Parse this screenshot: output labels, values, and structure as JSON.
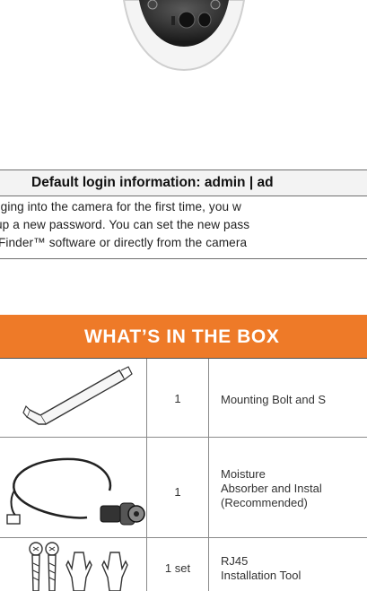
{
  "login_info": {
    "text": "Default login information: admin | ad"
  },
  "notice": {
    "lines": [
      "gging into the camera for the first time, you w",
      "up a new password. You can set the new pass",
      "Finder™ software or directly from the camera"
    ]
  },
  "box": {
    "title": "WHAT’S IN THE BOX",
    "items": [
      {
        "qty": "1",
        "label_lines": [
          "Mounting Bolt and S"
        ]
      },
      {
        "qty": "1",
        "label_lines": [
          "Moisture",
          "Absorber and Instal",
          "(Recommended)"
        ]
      },
      {
        "qty": "1 set",
        "label_lines": [
          "RJ45",
          "Installation Tool"
        ]
      }
    ]
  },
  "colors": {
    "accent": "#ee7a28",
    "border": "#6f6f6f",
    "login_bg": "#f3f3f3"
  }
}
